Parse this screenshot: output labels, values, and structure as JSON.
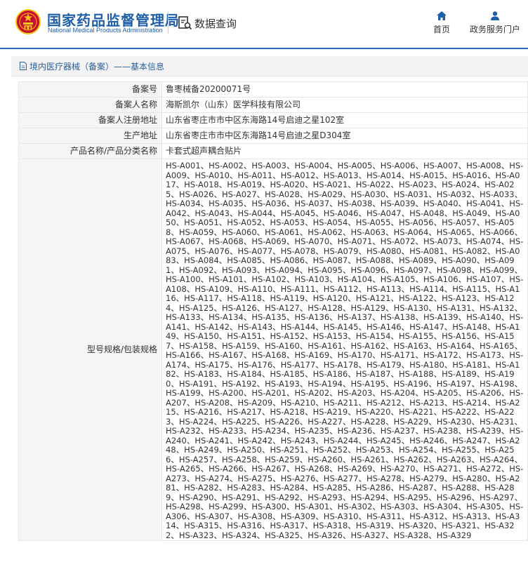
{
  "header": {
    "logo_cn": "国家药品监督管理局",
    "logo_en": "National Medical Products Administration",
    "query_icon": "search-document-icon",
    "query_label": "数据查询",
    "nav": [
      {
        "label": "首页",
        "icon": "home-icon"
      },
      {
        "label": "政务服务门户",
        "icon": "user-icon"
      }
    ]
  },
  "section": {
    "title": "境内医疗器械（备案）——基本信息"
  },
  "table": {
    "rows": [
      {
        "label": "备案号",
        "value": "鲁枣械备20200071号"
      },
      {
        "label": "备案人名称",
        "value": "海斯凯尔（山东）医学科技有限公司"
      },
      {
        "label": "备案人注册地址",
        "value": "山东省枣庄市市中区东海路14号启迪之星102室"
      },
      {
        "label": "生产地址",
        "value": "山东省枣庄市市中区东海路14号启迪之星D304室"
      },
      {
        "label": "产品名称/产品分类名称",
        "value": "卡套式超声耦合贴片"
      }
    ],
    "models_label": "型号规格/包装规格",
    "models_value": "HS-A001、HS-A002、HS-A003、HS-A004、HS-A005、HS-A006、HS-A007、HS-A008、HS-A009、HS-A010、HS-A011、HS-A012、HS-A013、HS-A014、HS-A015、HS-A016、HS-A017、HS-A018、HS-A019、HS-A020、HS-A021、HS-A022、HS-A023、HS-A024、HS-A025、HS-A026、HS-A027、HS-A028、HS-A029、HS-A030、HS-A031、HS-A032、HS-A033、HS-A034、HS-A035、HS-A036、HS-A037、HS-A038、HS-A039、HS-A040、HS-A041、HS-A042、HS-A043、HS-A044、HS-A045、HS-A046、HS-A047、HS-A048、HS-A049、HS-A050、HS-A051、HS-A052、HS-A053、HS-A054、HS-A055、HS-A056、HS-A057、HS-A058、HS-A059、HS-A060、HS-A061、HS-A062、HS-A063、HS-A064、HS-A065、HS-A066、HS-A067、HS-A068、HS-A069、HS-A070、HS-A071、HS-A072、HS-A073、HS-A074、HS-A075、HS-A076、HS-A077、HS-A078、HS-A079、HS-A080、HS-A081、HS-A082、HS-A083、HS-A084、HS-A085、HS-A086、HS-A087、HS-A088、HS-A089、HS-A090、HS-A091、HS-A092、HS-A093、HS-A094、HS-A095、HS-A096、HS-A097、HS-A098、HS-A099、HS-A100、HS-A101、HS-A102、HS-A103、HS-A104、HS-A105、HS-A106、HS-A107、HS-A108、HS-A109、HS-A110、HS-A111、HS-A112、HS-A113、HS-A114、HS-A115、HS-A116、HS-A117、HS-A118、HS-A119、HS-A120、HS-A121、HS-A122、HS-A123、HS-A124、HS-A125、HS-A126、HS-A127、HS-A128、HS-A129、HS-A130、HS-A131、HS-A132、HS-A133、HS-A134、HS-A135、HS-A136、HS-A137、HS-A138、HS-A139、HS-A140、HS-A141、HS-A142、HS-A143、HS-A144、HS-A145、HS-A146、HS-A147、HS-A148、HS-A149、HS-A150、HS-A151、HS-A152、HS-A153、HS-A154、HS-A155、HS-A156、HS-A157、HS-A158、HS-A159、HS-A160、HS-A161、HS-A162、HS-A163、HS-A164、HS-A165、HS-A166、HS-A167、HS-A168、HS-A169、HS-A170、HS-A171、HS-A172、HS-A173、HS-A174、HS-A175、HS-A176、HS-A177、HS-A178、HS-A179、HS-A180、HS-A181、HS-A182、HS-A183、HS-A184、HS-A185、HS-A186、HS-A187、HS-A188、HS-A189、HS-A190、HS-A191、HS-A192、HS-A193、HS-A194、HS-A195、HS-A196、HS-A197、HS-A198、HS-A199、HS-A200、HS-A201、HS-A202、HS-A203、HS-A204、HS-A205、HS-A206、HS-A207、HS-A208、HS-A209、HS-A210、HS-A211、HS-A212、HS-A213、HS-A214、HS-A215、HS-A216、HS-A217、HS-A218、HS-A219、HS-A220、HS-A221、HS-A222、HS-A223、HS-A224、HS-A225、HS-A226、HS-A227、HS-A228、HS-A229、HS-A230、HS-A231、HS-A232、HS-A233、HS-A234、HS-A235、HS-A236、HS-A237、HS-A238、HS-A239、HS-A240、HS-A241、HS-A242、HS-A243、HS-A244、HS-A245、HS-A246、HS-A247、HS-A248、HS-A249、HS-A250、HS-A251、HS-A252、HS-A253、HS-A254、HS-A255、HS-A256、HS-A257、HS-A258、HS-A259、HS-A260、HS-A261、HS-A262、HS-A263、HS-A264、HS-A265、HS-A266、HS-A267、HS-A268、HS-A269、HS-A270、HS-A271、HS-A272、HS-A273、HS-A274、HS-A275、HS-A276、HS-A277、HS-A278、HS-A279、HS-A280、HS-A281、HS-A282、HS-A283、HS-A284、HS-A285、HS-A286、HS-A287、HS-A288、HS-A289、HS-A290、HS-A291、HS-A292、HS-A293、HS-A294、HS-A295、HS-A296、HS-A297、HS-A298、HS-A299、HS-A300、HS-A301、HS-A302、HS-A303、HS-A304、HS-A305、HS-A306、HS-A307、HS-A308、HS-A309、HS-A310、HS-A311、HS-A312、HS-A313、HS-A314、HS-A315、HS-A316、HS-A317、HS-A318、HS-A319、HS-A320、HS-A321、HS-A322、HS-A323、HS-A324、HS-A325、HS-A326、HS-A327、HS-A328、HS-A329"
  },
  "colors": {
    "brand_blue": "#1f5fa8",
    "emblem_red": "#c8102e",
    "emblem_gold": "#f5c518",
    "label_bg": "#f5f5f5"
  }
}
